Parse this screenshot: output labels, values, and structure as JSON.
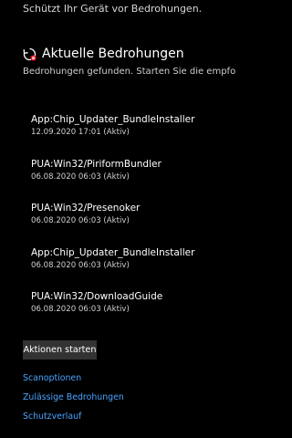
{
  "protection_text": "Schützt Ihr Gerät vor Bedrohungen.",
  "current_threats": {
    "icon": "threat-scan-icon",
    "title": "Aktuelle Bedrohungen",
    "subtitle": "Bedrohungen gefunden. Starten Sie die empfohle",
    "items": [
      {
        "name": "App:Chip_Updater_BundleInstaller",
        "meta": "12.09.2020 17:01 (Aktiv)"
      },
      {
        "name": "PUA:Win32/PiriformBundler",
        "meta": "06.08.2020 06:03 (Aktiv)"
      },
      {
        "name": "PUA:Win32/Presenoker",
        "meta": "06.08.2020 06:03 (Aktiv)"
      },
      {
        "name": "App:Chip_Updater_BundleInstaller",
        "meta": "06.08.2020 06:03 (Aktiv)"
      },
      {
        "name": "PUA:Win32/DownloadGuide",
        "meta": "06.08.2020 06:03 (Aktiv)"
      }
    ],
    "action_button": "Aktionen starten"
  },
  "links": {
    "scan_options": "Scanoptionen",
    "allowed_threats": "Zulässige Bedrohungen",
    "protection_history": "Schutzverlauf"
  },
  "colors": {
    "background": "#000000",
    "link": "#4aa3ff",
    "button": "#333333",
    "threat_icon_accent": "#e81123"
  }
}
